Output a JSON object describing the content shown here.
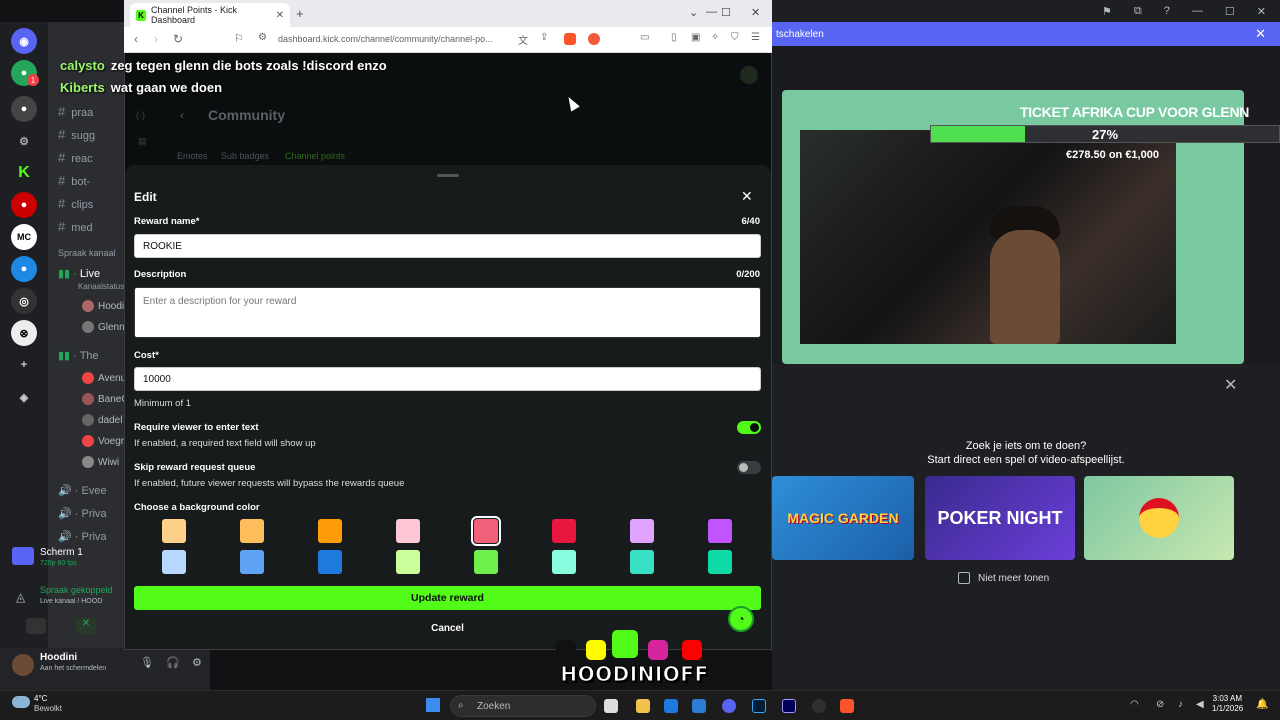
{
  "browser": {
    "tab_title": "Channel Points - Kick Dashboard",
    "url": "dashboard.kick.com/channel/community/channel-po...",
    "favicon": "K"
  },
  "chat_overlay": [
    {
      "user": "calysto",
      "message": "zeg tegen glenn die bots zoals !discord enzo"
    },
    {
      "user": "Kiberts",
      "message": "wat gaan we doen"
    }
  ],
  "page_behind": {
    "title": "Community",
    "tabs": [
      "Emotes",
      "Sub badges",
      "Channel points"
    ]
  },
  "modal": {
    "title": "Edit",
    "reward_name_label": "Reward name*",
    "reward_name_count": "6/40",
    "reward_name_value": "ROOKIE",
    "description_label": "Description",
    "description_count": "0/200",
    "description_placeholder": "Enter a description for your reward",
    "cost_label": "Cost*",
    "cost_value": "10000",
    "cost_hint": "Minimum of 1",
    "require_text_label": "Require viewer to enter text",
    "require_text_hint": "If enabled, a required text field will show up",
    "require_text_enabled": true,
    "skip_queue_label": "Skip reward request queue",
    "skip_queue_hint": "If enabled, future viewer requests will bypass the rewards queue",
    "skip_queue_enabled": false,
    "color_label": "Choose a background color",
    "colors_row1": [
      "#ffd08a",
      "#ffbe5c",
      "#ff9c0a",
      "#ffc7d6",
      "#f2617a",
      "#e8173f",
      "#e0a3ff",
      "#c154ff"
    ],
    "colors_row2": [
      "#b9d8ff",
      "#5fa3f5",
      "#1f7ae0",
      "#caff9c",
      "#6ff04d",
      "#8affdf",
      "#36e0c2",
      "#0fd9a4"
    ],
    "selected_color_index": 4,
    "update_button": "Update reward",
    "cancel_button": "Cancel"
  },
  "discord": {
    "channels": [
      "praa",
      "sugg",
      "reac",
      "bot-",
      "clips",
      "med"
    ],
    "voice_header": "Spraak kanaal",
    "live_label": "Live",
    "live_status": "Kanaalstatus",
    "users_live": [
      "Hoodi",
      "Glenn"
    ],
    "the_label": "The",
    "users_the": [
      "Avenu",
      "BaneG",
      "dadel",
      "Voegr",
      "Wiwi"
    ],
    "voice_more": [
      "Evee",
      "Priva",
      "Priva"
    ],
    "screen_title": "Scherm 1",
    "screen_sub": "720p 60 fps",
    "connected": "Spraak gekoppeld",
    "connected_sub": "Live kanaal / HOOD",
    "username": "Hoodini",
    "user_status": "Aan het schermdelen",
    "banner_text": "tschakelen",
    "activity_line1": "Zoek je iets om te doen?",
    "activity_line2": "Start direct een spel of video-afspeellijst.",
    "games": [
      "MAGIC GARDEN",
      "POKER NIGHT",
      ""
    ],
    "no_show_label": "Niet meer tonen"
  },
  "stream_overlay": {
    "ticket_title": "TICKET AFRIKA CUP VOOR GLENN",
    "progress_pct": "27%",
    "progress_value": 0.27,
    "amount": "€278.50 on €1,000",
    "brand_name": "HOODINIOFF"
  },
  "taskbar": {
    "weather_temp": "4°C",
    "weather_desc": "Bewolkt",
    "search_placeholder": "Zoeken",
    "time": "3:03 AM",
    "date": "1/1/2026"
  }
}
